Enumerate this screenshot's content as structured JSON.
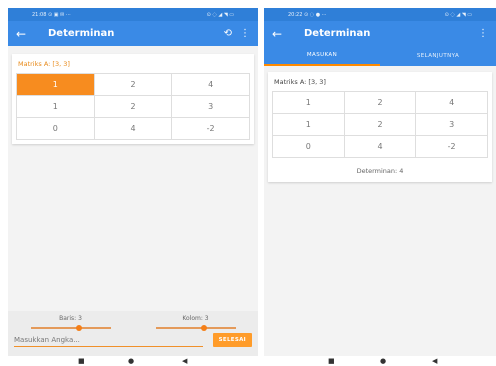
{
  "left_screen": {
    "status": {
      "time": "21:08",
      "icons": "⊙ ▣ ✉ ···",
      "right_icons": "⊙ ◌ ◢ ◥ ▭"
    },
    "appbar": {
      "back_icon": "←",
      "title": "Determinan",
      "refresh_icon": "⟲",
      "menu_icon": "⋮"
    },
    "caption": "Matriks A: [3, 3]",
    "matrix": [
      [
        "1",
        "2",
        "4"
      ],
      [
        "1",
        "2",
        "3"
      ],
      [
        "0",
        "4",
        "-2"
      ]
    ],
    "controls": {
      "rows_label": "Baris: 3",
      "cols_label": "Kolom: 3",
      "rows_slider_fraction": 0.6,
      "cols_slider_fraction": 0.6,
      "input_placeholder": "Masukkan Angka...",
      "done_label": "SELESAI"
    }
  },
  "right_screen": {
    "status": {
      "time": "20:22",
      "icons": "⊙ ◌ ● ···",
      "right_icons": "⊙ ◌ ◢ ◥ ▭"
    },
    "appbar": {
      "back_icon": "←",
      "title": "Determinan",
      "menu_icon": "⋮"
    },
    "tabs": [
      {
        "label": "MASUKAN"
      },
      {
        "label": "SELANJUTNYA"
      }
    ],
    "caption": "Matriks A: [3, 3]",
    "matrix": [
      [
        "1",
        "2",
        "4"
      ],
      [
        "1",
        "2",
        "3"
      ],
      [
        "0",
        "4",
        "-2"
      ]
    ],
    "determinant": "Determinan: 4"
  },
  "navbar": {
    "recent_icon": "■",
    "home_icon": "●",
    "back_icon": "◀"
  },
  "colors": {
    "primary": "#3a8ae6",
    "accent": "#f78c1f"
  }
}
